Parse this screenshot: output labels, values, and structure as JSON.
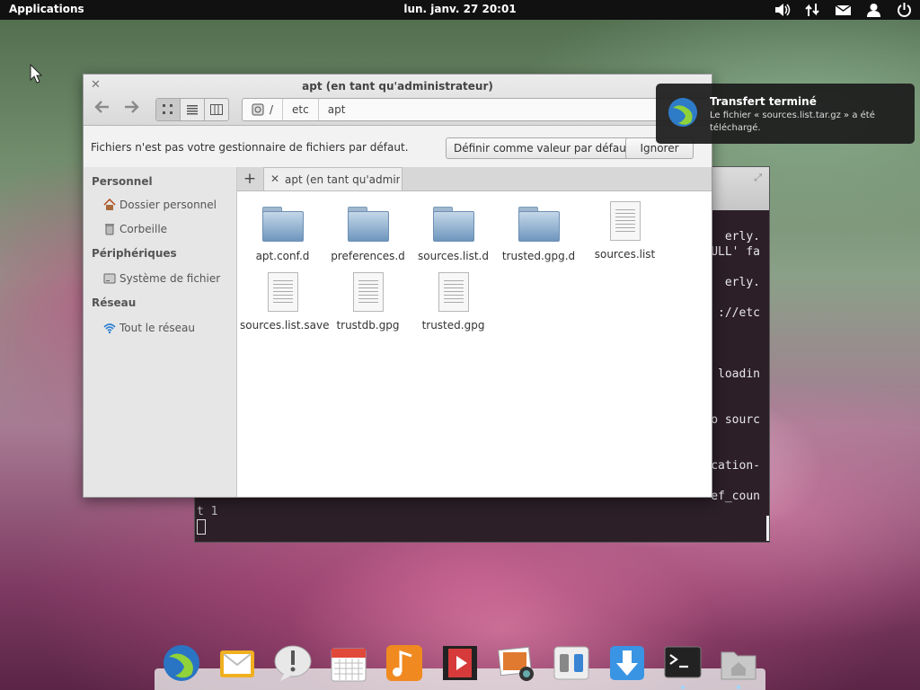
{
  "panel": {
    "applications": "Applications",
    "clock": "lun. janv. 27 20:01",
    "indicators": [
      "volume-icon",
      "network-icon",
      "mail-icon",
      "user-icon",
      "power-icon"
    ]
  },
  "terminal": {
    "lines": [
      "erly.",
      "ULL' fa",
      "erly.",
      "://etc",
      "loadin",
      "o sourc",
      "cation-",
      "ef_coun"
    ],
    "last_line": "t 1"
  },
  "file_manager": {
    "title": "apt (en tant qu'administrateur)",
    "path": [
      "/",
      "etc",
      "apt"
    ],
    "infobar": {
      "message": "Fichiers n'est pas votre gestionnaire de fichiers par défaut.",
      "set_default_label": "Définir comme valeur par défaut",
      "ignore_label": "Ignorer"
    },
    "sidebar": {
      "sections": [
        {
          "title": "Personnel",
          "items": [
            "Dossier personnel",
            "Corbeille"
          ]
        },
        {
          "title": "Périphériques",
          "items": [
            "Système de fichier"
          ]
        },
        {
          "title": "Réseau",
          "items": [
            "Tout le réseau"
          ]
        }
      ]
    },
    "tab_label": "apt (en tant qu'admini…",
    "files": [
      {
        "name": "apt.conf.d",
        "type": "folder"
      },
      {
        "name": "preferences.d",
        "type": "folder"
      },
      {
        "name": "sources.list.d",
        "type": "folder"
      },
      {
        "name": "trusted.gpg.d",
        "type": "folder"
      },
      {
        "name": "sources.list",
        "type": "file"
      },
      {
        "name": "sources.list.save",
        "type": "file"
      },
      {
        "name": "trustdb.gpg",
        "type": "file"
      },
      {
        "name": "trusted.gpg",
        "type": "file"
      }
    ]
  },
  "notification": {
    "title": "Transfert terminé",
    "body": "Le fichier « sources.list.tar.gz » a été téléchargé."
  },
  "dock": {
    "apps": [
      "browser-icon",
      "mail-icon",
      "alert-icon",
      "calendar-icon",
      "music-icon",
      "video-icon",
      "photos-icon",
      "settings-icon",
      "downloads-icon",
      "terminal-icon",
      "files-icon"
    ]
  }
}
